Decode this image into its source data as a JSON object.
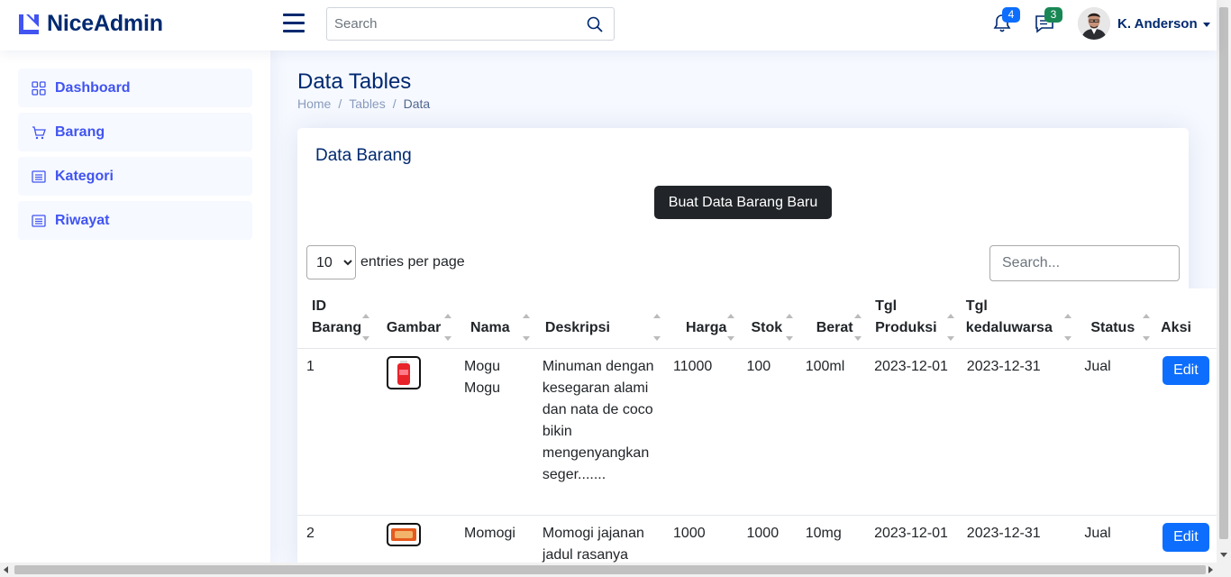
{
  "app": {
    "name": "NiceAdmin"
  },
  "header": {
    "search_placeholder": "Search",
    "notifications_count": "4",
    "messages_count": "3",
    "user_name": "K. Anderson",
    "colors": {
      "notif_badge": "#0d6efd",
      "msg_badge": "#198754"
    }
  },
  "sidebar": {
    "items": [
      {
        "label": "Dashboard",
        "icon": "grid-icon"
      },
      {
        "label": "Barang",
        "icon": "cart-icon"
      },
      {
        "label": "Kategori",
        "icon": "list-icon"
      },
      {
        "label": "Riwayat",
        "icon": "list-icon"
      }
    ]
  },
  "page": {
    "title": "Data Tables",
    "breadcrumb": [
      "Home",
      "Tables",
      "Data"
    ]
  },
  "card": {
    "title": "Data Barang",
    "new_button": "Buat Data Barang Baru",
    "per_page_value": "10",
    "per_page_label": "entries per page",
    "search_placeholder": "Search..."
  },
  "table": {
    "headers": [
      "ID Barang",
      "Gambar",
      "Nama",
      "Deskripsi",
      "Harga",
      "Stok",
      "Berat",
      "Tgl Produksi",
      "Tgl kedaluwarsa",
      "Status",
      "Aksi"
    ],
    "rows": [
      {
        "id": "1",
        "image": "drink-can-image",
        "nama": "Mogu Mogu",
        "deskripsi": "Minuman dengan kesegaran alami dan nata de coco bikin mengenyangkan seger.......",
        "harga": "11000",
        "stok": "100",
        "berat": "100ml",
        "produksi": "2023-12-01",
        "kedaluwarsa": "2023-12-31",
        "status": "Jual",
        "aksi": "Edit"
      },
      {
        "id": "2",
        "image": "snack-pack-image",
        "nama": "Momogi",
        "deskripsi": "Momogi jajanan jadul rasanya",
        "harga": "1000",
        "stok": "1000",
        "berat": "10mg",
        "produksi": "2023-12-01",
        "kedaluwarsa": "2023-12-31",
        "status": "Jual",
        "aksi": "Edit"
      }
    ]
  }
}
